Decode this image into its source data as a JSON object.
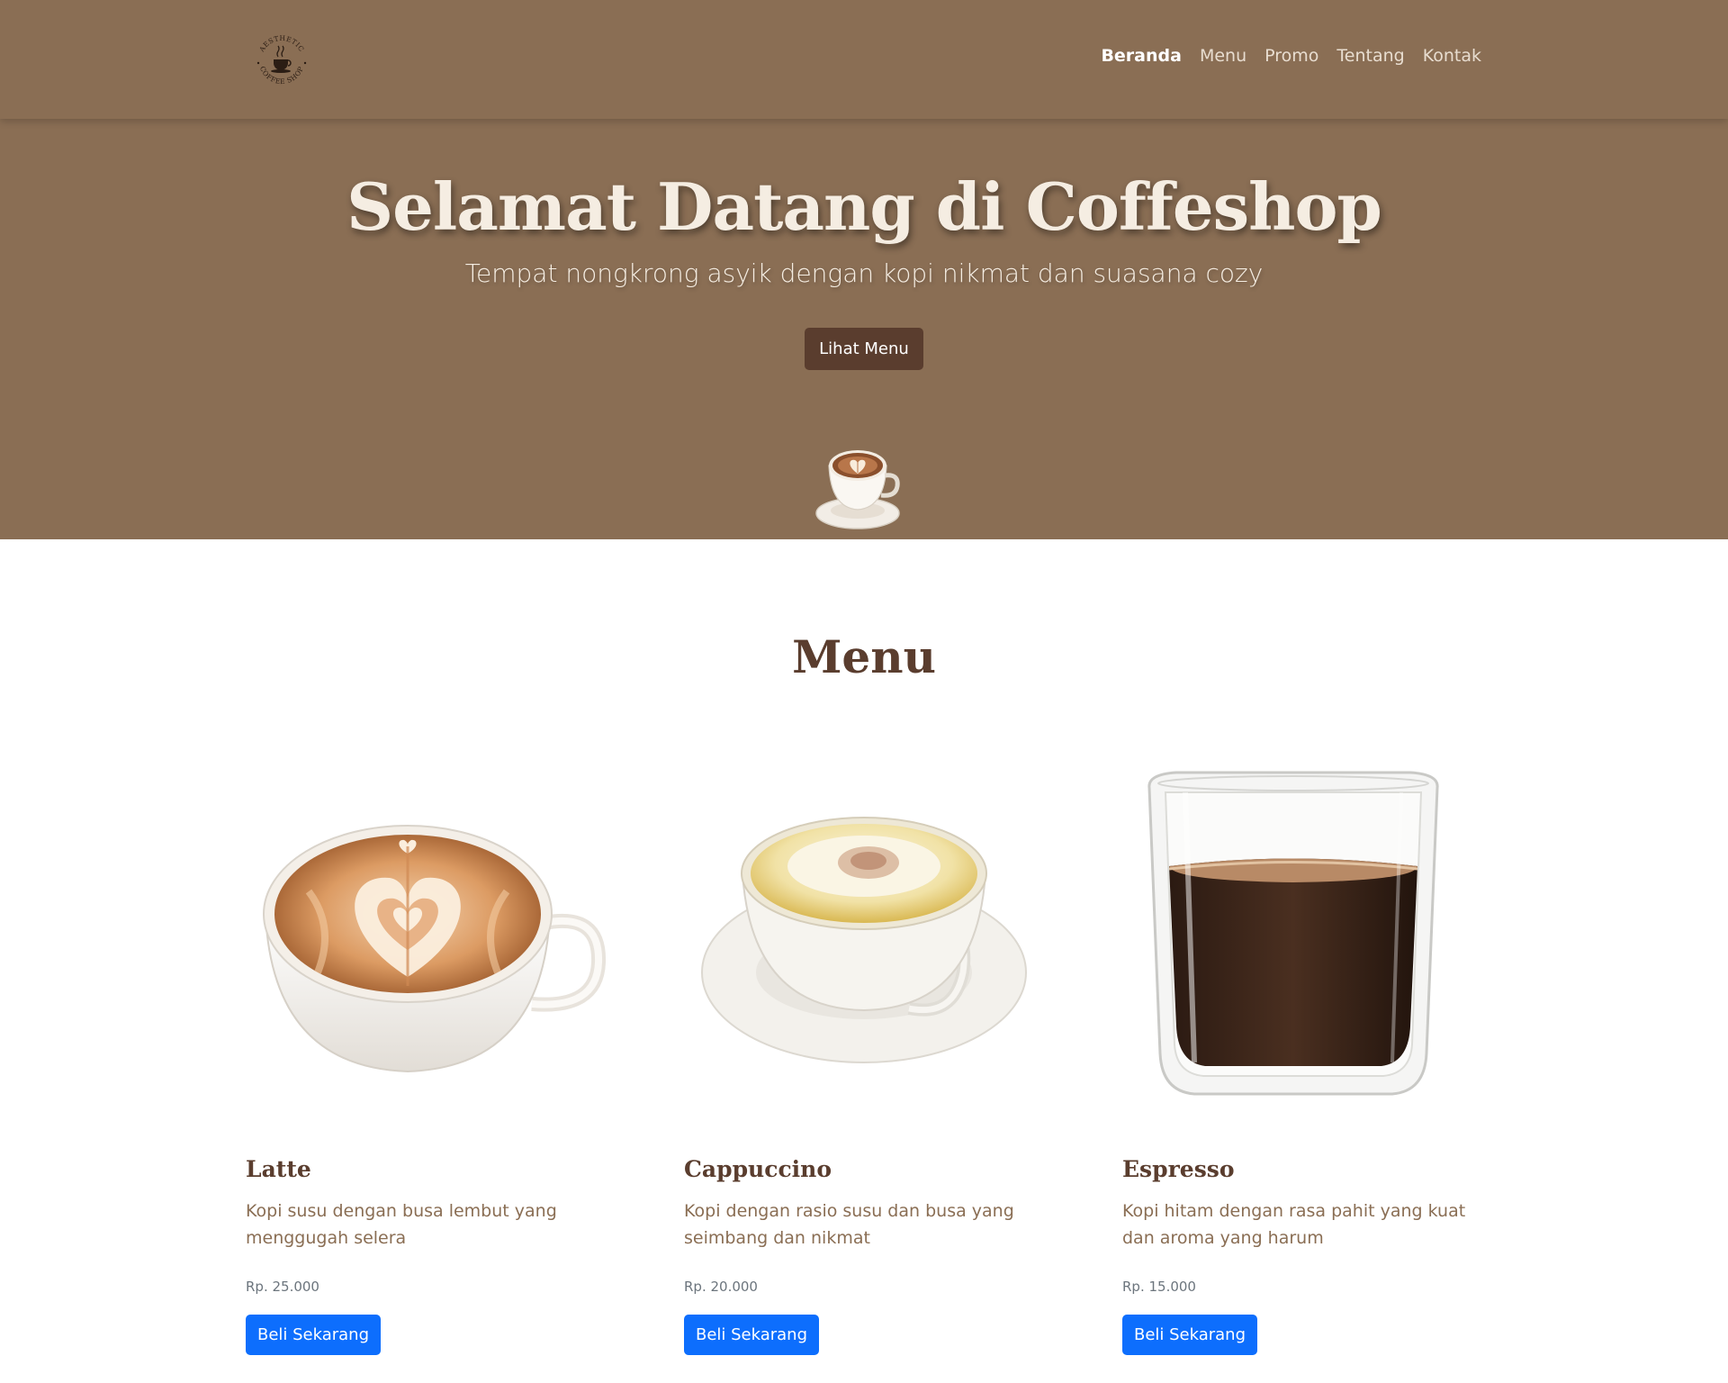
{
  "navbar": {
    "logo": {
      "icon": "coffee-cup-logo-icon",
      "top_text": "AESTHETIC",
      "bottom_text": "COFFEE SHOP"
    },
    "links": [
      {
        "label": "Beranda",
        "active": true
      },
      {
        "label": "Menu",
        "active": false
      },
      {
        "label": "Promo",
        "active": false
      },
      {
        "label": "Tentang",
        "active": false
      },
      {
        "label": "Kontak",
        "active": false
      }
    ]
  },
  "hero": {
    "title": "Selamat Datang di Coffeshop",
    "subtitle": "Tempat nongkrong asyik dengan kopi nikmat dan suasana cozy",
    "button_label": "Lihat Menu",
    "image_icon": "latte-cup-icon"
  },
  "menu": {
    "heading": "Menu",
    "items": [
      {
        "name": "Latte",
        "description": "Kopi susu dengan busa lembut yang menggugah selera",
        "price": "Rp. 25.000",
        "button_label": "Beli Sekarang",
        "image_icon": "latte-art-cup-icon"
      },
      {
        "name": "Cappuccino",
        "description": "Kopi dengan rasio susu dan busa yang seimbang dan nikmat",
        "price": "Rp. 20.000",
        "button_label": "Beli Sekarang",
        "image_icon": "cappuccino-cup-icon"
      },
      {
        "name": "Espresso",
        "description": "Kopi hitam dengan rasa pahit yang kuat dan aroma yang harum",
        "price": "Rp. 15.000",
        "button_label": "Beli Sekarang",
        "image_icon": "espresso-glass-icon"
      }
    ]
  },
  "colors": {
    "brand_brown": "#8a6e54",
    "dark_brown": "#5a3d2e",
    "cream": "#f5ede2",
    "primary_blue": "#0d6efd"
  }
}
